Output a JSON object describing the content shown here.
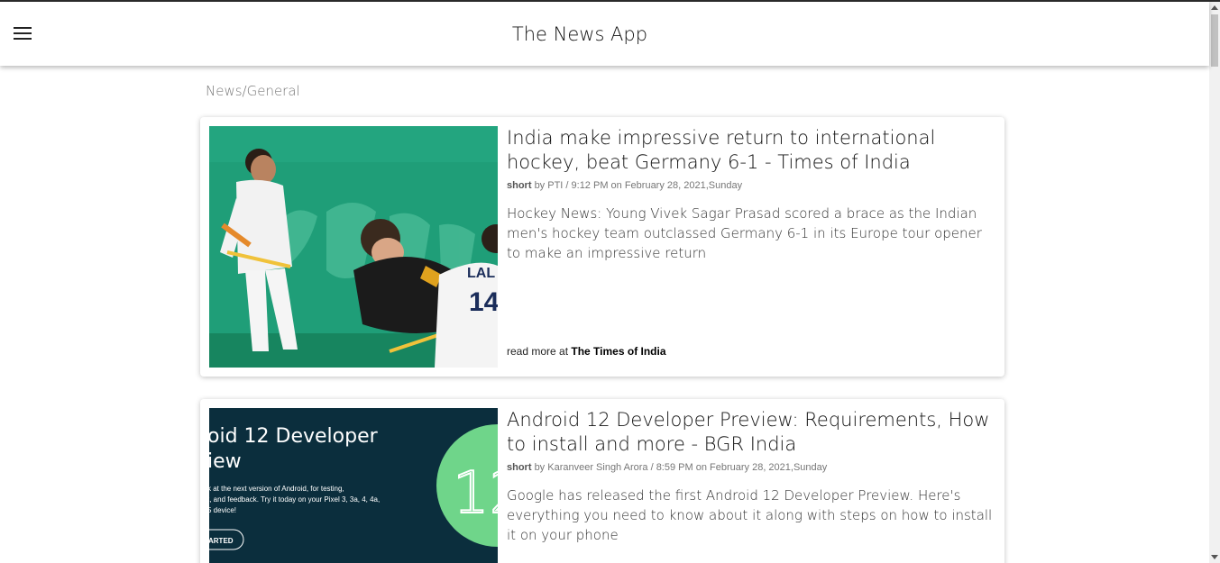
{
  "header": {
    "title": "The News App",
    "menu_icon": "hamburger-menu-icon"
  },
  "breadcrumb": "News/General",
  "articles": [
    {
      "title": "India make impressive return to international hockey, beat Germany 6-1 - Times of India",
      "tag": "short",
      "meta": "by PTI / 9:12 PM on February 28, 2021,Sunday",
      "description": "Hockey News: Young Vivek Sagar Prasad scored a brace as the Indian men's hockey team outclassed Germany 6-1 in its Europe tour opener to make an impressive return",
      "read_more_prefix": "read more at",
      "source": "The Times of India",
      "image_jersey_number": "14",
      "image_jersey_name": "LAL"
    },
    {
      "title": "Android 12 Developer Preview: Requirements, How to install and more - BGR India",
      "tag": "short",
      "meta": "by Karanveer Singh Arora / 8:59 PM on February 28, 2021,Sunday",
      "description": "Google has released the first Android 12 Developer Preview. Here's everything you need to know about it along with steps on how to install it on your phone",
      "image_headline_line1": "oid 12 Developer",
      "image_headline_line2": "iew",
      "image_body_line1": "k at the next version of Android, for testing,",
      "image_body_line2": "t, and feedback. Try it today on your Pixel 3, 3a, 4, 4a,",
      "image_body_line3": "5 device!",
      "image_button": "ARTED",
      "image_logo_text": "12"
    }
  ],
  "colors": {
    "header_bg": "#ffffff",
    "page_bg": "#ffffff",
    "android_bg": "#0b2e3d",
    "android_logo": "#6fd58a"
  }
}
